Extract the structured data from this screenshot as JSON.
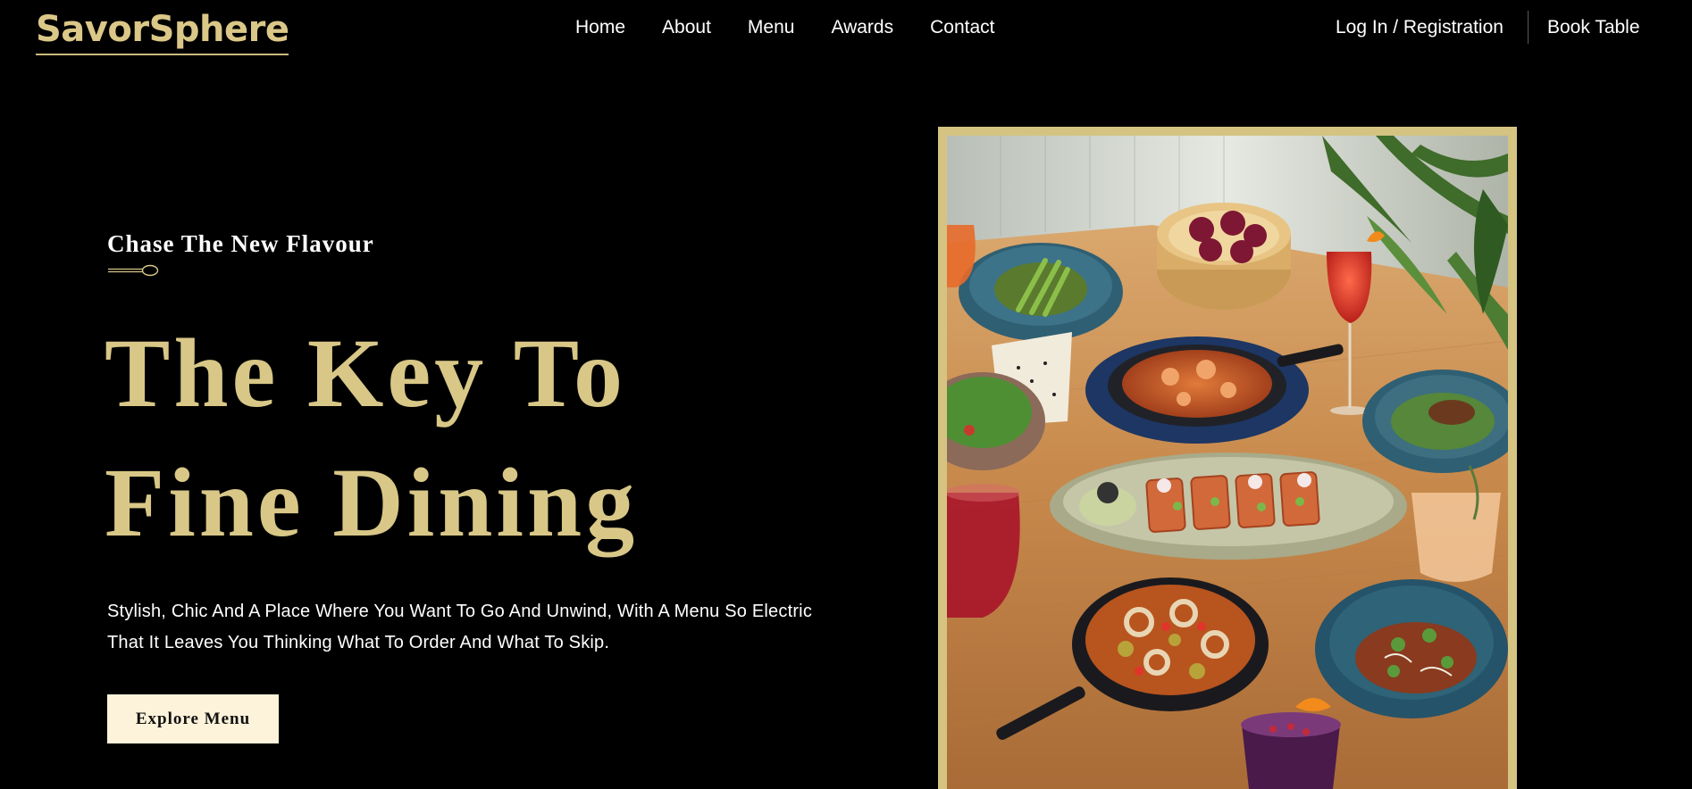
{
  "brand": {
    "name": "SavorSphere",
    "accent_color": "#d8c787"
  },
  "nav": {
    "items": [
      {
        "label": "Home"
      },
      {
        "label": "About"
      },
      {
        "label": "Menu"
      },
      {
        "label": "Awards"
      },
      {
        "label": "Contact"
      }
    ],
    "auth_label": "Log In / Registration",
    "book_label": "Book Table"
  },
  "hero": {
    "eyebrow": "Chase The New Flavour",
    "divider_icon": "spoon-icon",
    "title_line1": "The Key To",
    "title_line2": "Fine Dining",
    "description": "Stylish, Chic And A Place Where You Want To Go And Unwind, With A Menu So Electric That It Leaves You Thinking What To Order And What To Skip.",
    "cta_label": "Explore Menu",
    "image_subject": "food-table-photo"
  }
}
